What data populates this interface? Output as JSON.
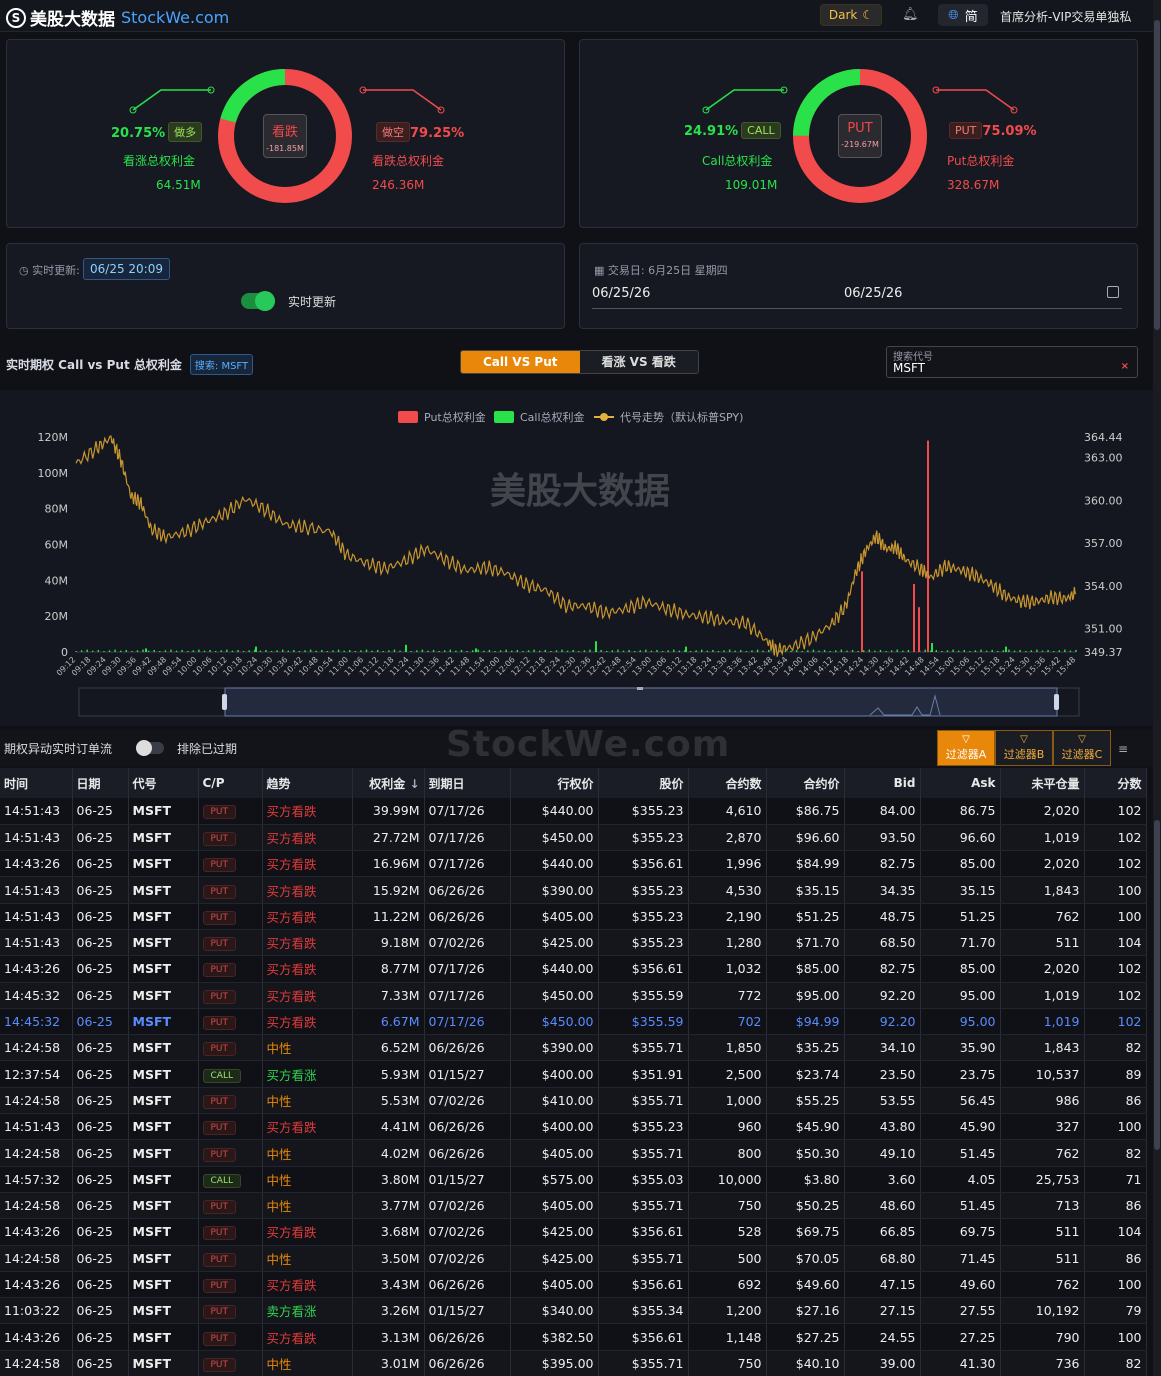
{
  "header": {
    "logo_mark": "S",
    "logo_cn": "美股大数据",
    "logo_en": "StockWe.com",
    "dark_label": "Dark",
    "lang_label": "简",
    "nav_text": "首席分析-VIP交易单独私"
  },
  "panel1": {
    "center_title": "看跌",
    "center_value": "-181.85M",
    "left_pct": "20.75%",
    "left_tag": "做多",
    "left_label": "看涨总权利金",
    "left_value": "64.51M",
    "right_tag": "做空",
    "right_pct": "79.25%",
    "right_label": "看跌总权利金",
    "right_value": "246.36M",
    "green_fraction": 0.2075
  },
  "panel2": {
    "center_title": "PUT",
    "center_value": "-219.67M",
    "left_pct": "24.91%",
    "left_tag": "CALL",
    "left_label": "Call总权利金",
    "left_value": "109.01M",
    "right_tag": "PUT",
    "right_pct": "75.09%",
    "right_label": "Put总权利金",
    "right_value": "328.67M",
    "green_fraction": 0.2491
  },
  "realtime": {
    "label": "实时更新:",
    "time": "06/25 20:09",
    "toggle_label": "实时更新"
  },
  "dates": {
    "label": "交易日: 6月25日 星期四",
    "start": "06/25/26",
    "end": "06/25/26"
  },
  "chart_header": {
    "title": "实时期权 Call vs Put 总权利金",
    "search_badge": "搜索: MSFT",
    "seg_active": "Call VS Put",
    "seg_inactive": "看涨 VS 看跌",
    "search_label": "搜索代号",
    "search_value": "MSFT",
    "search_clear": "×"
  },
  "colors": {
    "put": "#f24b4b",
    "call": "#29e24a",
    "price_line": "#c8962e",
    "accent": "#e8870a"
  },
  "chart_data": {
    "type": "bar",
    "watermark": "美股大数据",
    "legend": [
      "Put总权利金",
      "Call总权利金",
      "代号走势（默认标普SPY)"
    ],
    "legend_position": "top-center",
    "ylim_left": [
      0,
      120
    ],
    "yticks_left": [
      "0",
      "20M",
      "40M",
      "60M",
      "80M",
      "100M",
      "120M"
    ],
    "ylim_right": [
      349.37,
      364.44
    ],
    "yticks_right": [
      "349.37",
      "351.00",
      "354.00",
      "357.00",
      "360.00",
      "363.00",
      "364.44"
    ],
    "x_ticks": [
      "09:12",
      "09:18",
      "09:24",
      "09:30",
      "09:36",
      "09:42",
      "09:48",
      "09:54",
      "10:00",
      "10:06",
      "10:12",
      "10:18",
      "10:24",
      "10:30",
      "10:36",
      "10:42",
      "10:48",
      "10:54",
      "11:00",
      "11:06",
      "11:12",
      "11:18",
      "11:24",
      "11:30",
      "11:36",
      "11:42",
      "11:48",
      "11:54",
      "12:00",
      "12:06",
      "12:12",
      "12:18",
      "12:24",
      "12:30",
      "12:36",
      "12:42",
      "12:48",
      "12:54",
      "13:00",
      "13:06",
      "13:12",
      "13:18",
      "13:24",
      "13:30",
      "13:36",
      "13:42",
      "13:48",
      "13:54",
      "14:00",
      "14:06",
      "14:12",
      "14:18",
      "14:24",
      "14:30",
      "14:36",
      "14:42",
      "14:48",
      "14:54",
      "15:00",
      "15:06",
      "15:12",
      "15:18",
      "15:24",
      "15:30",
      "15:36",
      "15:42",
      "15:48"
    ],
    "price_series": [
      {
        "t": 0.0,
        "p": 362.6
      },
      {
        "t": 0.02,
        "p": 363.6
      },
      {
        "t": 0.035,
        "p": 364.4
      },
      {
        "t": 0.045,
        "p": 362.8
      },
      {
        "t": 0.055,
        "p": 360.3
      },
      {
        "t": 0.065,
        "p": 359.8
      },
      {
        "t": 0.075,
        "p": 358.0
      },
      {
        "t": 0.09,
        "p": 357.4
      },
      {
        "t": 0.11,
        "p": 357.8
      },
      {
        "t": 0.13,
        "p": 358.5
      },
      {
        "t": 0.15,
        "p": 359.1
      },
      {
        "t": 0.17,
        "p": 360.1
      },
      {
        "t": 0.19,
        "p": 359.3
      },
      {
        "t": 0.21,
        "p": 358.3
      },
      {
        "t": 0.23,
        "p": 358.1
      },
      {
        "t": 0.255,
        "p": 357.8
      },
      {
        "t": 0.27,
        "p": 356.2
      },
      {
        "t": 0.29,
        "p": 355.6
      },
      {
        "t": 0.31,
        "p": 355.2
      },
      {
        "t": 0.33,
        "p": 355.8
      },
      {
        "t": 0.35,
        "p": 356.6
      },
      {
        "t": 0.37,
        "p": 355.8
      },
      {
        "t": 0.39,
        "p": 355.1
      },
      {
        "t": 0.41,
        "p": 355.3
      },
      {
        "t": 0.43,
        "p": 354.9
      },
      {
        "t": 0.45,
        "p": 354.1
      },
      {
        "t": 0.47,
        "p": 353.7
      },
      {
        "t": 0.49,
        "p": 352.6
      },
      {
        "t": 0.51,
        "p": 352.6
      },
      {
        "t": 0.53,
        "p": 352.1
      },
      {
        "t": 0.55,
        "p": 352.4
      },
      {
        "t": 0.57,
        "p": 352.9
      },
      {
        "t": 0.59,
        "p": 352.4
      },
      {
        "t": 0.61,
        "p": 352.0
      },
      {
        "t": 0.63,
        "p": 351.8
      },
      {
        "t": 0.65,
        "p": 351.5
      },
      {
        "t": 0.67,
        "p": 351.4
      },
      {
        "t": 0.69,
        "p": 350.2
      },
      {
        "t": 0.7,
        "p": 349.5
      },
      {
        "t": 0.715,
        "p": 349.7
      },
      {
        "t": 0.735,
        "p": 350.3
      },
      {
        "t": 0.755,
        "p": 351.3
      },
      {
        "t": 0.77,
        "p": 352.6
      },
      {
        "t": 0.78,
        "p": 355.0
      },
      {
        "t": 0.79,
        "p": 356.5
      },
      {
        "t": 0.8,
        "p": 357.5
      },
      {
        "t": 0.81,
        "p": 356.6
      },
      {
        "t": 0.82,
        "p": 356.7
      },
      {
        "t": 0.83,
        "p": 355.8
      },
      {
        "t": 0.845,
        "p": 355.2
      },
      {
        "t": 0.855,
        "p": 354.6
      },
      {
        "t": 0.87,
        "p": 355.4
      },
      {
        "t": 0.885,
        "p": 355.1
      },
      {
        "t": 0.9,
        "p": 354.7
      },
      {
        "t": 0.915,
        "p": 354.1
      },
      {
        "t": 0.93,
        "p": 353.3
      },
      {
        "t": 0.945,
        "p": 352.9
      },
      {
        "t": 0.96,
        "p": 352.9
      },
      {
        "t": 0.975,
        "p": 353.2
      },
      {
        "t": 0.99,
        "p": 353.1
      },
      {
        "t": 1.0,
        "p": 353.5
      }
    ],
    "put_bars": [
      {
        "t": 0.786,
        "v": 45
      },
      {
        "t": 0.838,
        "v": 38
      },
      {
        "t": 0.843,
        "v": 25
      },
      {
        "t": 0.852,
        "v": 118
      }
    ],
    "call_bars": [
      {
        "t": 0.52,
        "v": 6
      },
      {
        "t": 0.33,
        "v": 4
      },
      {
        "t": 0.18,
        "v": 3
      },
      {
        "t": 0.61,
        "v": 3
      },
      {
        "t": 0.856,
        "v": 5
      },
      {
        "t": 0.07,
        "v": 2
      },
      {
        "t": 0.4,
        "v": 2
      },
      {
        "t": 0.93,
        "v": 3
      }
    ]
  },
  "flow": {
    "title": "期权异动实时订单流",
    "exclude_label": "排除已过期",
    "watermark": "StockWe.com",
    "filters": [
      "过滤器A",
      "过滤器B",
      "过滤器C"
    ],
    "columns": [
      "时间",
      "日期",
      "代号",
      "C/P",
      "趋势",
      "权利金",
      "到期日",
      "行权价",
      "股价",
      "合约数",
      "合约价",
      "Bid",
      "Ask",
      "未平仓量",
      "分数"
    ],
    "rows": [
      [
        "14:51:43",
        "06-25",
        "MSFT",
        "PUT",
        "买方看跌",
        "39.99M",
        "07/17/26",
        "$440.00",
        "$355.23",
        "4,610",
        "$86.75",
        "84.00",
        "86.75",
        "2,020",
        "102"
      ],
      [
        "14:51:43",
        "06-25",
        "MSFT",
        "PUT",
        "买方看跌",
        "27.72M",
        "07/17/26",
        "$450.00",
        "$355.23",
        "2,870",
        "$96.60",
        "93.50",
        "96.60",
        "1,019",
        "102"
      ],
      [
        "14:43:26",
        "06-25",
        "MSFT",
        "PUT",
        "买方看跌",
        "16.96M",
        "07/17/26",
        "$440.00",
        "$356.61",
        "1,996",
        "$84.99",
        "82.75",
        "85.00",
        "2,020",
        "102"
      ],
      [
        "14:51:43",
        "06-25",
        "MSFT",
        "PUT",
        "买方看跌",
        "15.92M",
        "06/26/26",
        "$390.00",
        "$355.23",
        "4,530",
        "$35.15",
        "34.35",
        "35.15",
        "1,843",
        "100"
      ],
      [
        "14:51:43",
        "06-25",
        "MSFT",
        "PUT",
        "买方看跌",
        "11.22M",
        "06/26/26",
        "$405.00",
        "$355.23",
        "2,190",
        "$51.25",
        "48.75",
        "51.25",
        "762",
        "100"
      ],
      [
        "14:51:43",
        "06-25",
        "MSFT",
        "PUT",
        "买方看跌",
        "9.18M",
        "07/02/26",
        "$425.00",
        "$355.23",
        "1,280",
        "$71.70",
        "68.50",
        "71.70",
        "511",
        "104"
      ],
      [
        "14:43:26",
        "06-25",
        "MSFT",
        "PUT",
        "买方看跌",
        "8.77M",
        "07/17/26",
        "$440.00",
        "$356.61",
        "1,032",
        "$85.00",
        "82.75",
        "85.00",
        "2,020",
        "102"
      ],
      [
        "14:45:32",
        "06-25",
        "MSFT",
        "PUT",
        "买方看跌",
        "7.33M",
        "07/17/26",
        "$450.00",
        "$355.59",
        "772",
        "$95.00",
        "92.20",
        "95.00",
        "1,019",
        "102"
      ],
      [
        "14:45:32",
        "06-25",
        "MSFT",
        "PUT",
        "买方看跌",
        "6.67M",
        "07/17/26",
        "$450.00",
        "$355.59",
        "702",
        "$94.99",
        "92.20",
        "95.00",
        "1,019",
        "102"
      ],
      [
        "14:24:58",
        "06-25",
        "MSFT",
        "PUT",
        "中性",
        "6.52M",
        "06/26/26",
        "$390.00",
        "$355.71",
        "1,850",
        "$35.25",
        "34.10",
        "35.90",
        "1,843",
        "82"
      ],
      [
        "12:37:54",
        "06-25",
        "MSFT",
        "CALL",
        "买方看涨",
        "5.93M",
        "01/15/27",
        "$400.00",
        "$351.91",
        "2,500",
        "$23.74",
        "23.50",
        "23.75",
        "10,537",
        "89"
      ],
      [
        "14:24:58",
        "06-25",
        "MSFT",
        "PUT",
        "中性",
        "5.53M",
        "07/02/26",
        "$410.00",
        "$355.71",
        "1,000",
        "$55.25",
        "53.55",
        "56.45",
        "986",
        "86"
      ],
      [
        "14:51:43",
        "06-25",
        "MSFT",
        "PUT",
        "买方看跌",
        "4.41M",
        "06/26/26",
        "$400.00",
        "$355.23",
        "960",
        "$45.90",
        "43.80",
        "45.90",
        "327",
        "100"
      ],
      [
        "14:24:58",
        "06-25",
        "MSFT",
        "PUT",
        "中性",
        "4.02M",
        "06/26/26",
        "$405.00",
        "$355.71",
        "800",
        "$50.30",
        "49.10",
        "51.45",
        "762",
        "82"
      ],
      [
        "14:57:32",
        "06-25",
        "MSFT",
        "CALL",
        "中性",
        "3.80M",
        "01/15/27",
        "$575.00",
        "$355.03",
        "10,000",
        "$3.80",
        "3.60",
        "4.05",
        "25,753",
        "71"
      ],
      [
        "14:24:58",
        "06-25",
        "MSFT",
        "PUT",
        "中性",
        "3.77M",
        "07/02/26",
        "$405.00",
        "$355.71",
        "750",
        "$50.25",
        "48.60",
        "51.45",
        "713",
        "86"
      ],
      [
        "14:43:26",
        "06-25",
        "MSFT",
        "PUT",
        "买方看跌",
        "3.68M",
        "07/02/26",
        "$425.00",
        "$356.61",
        "528",
        "$69.75",
        "66.85",
        "69.75",
        "511",
        "104"
      ],
      [
        "14:24:58",
        "06-25",
        "MSFT",
        "PUT",
        "中性",
        "3.50M",
        "07/02/26",
        "$425.00",
        "$355.71",
        "500",
        "$70.05",
        "68.80",
        "71.45",
        "511",
        "86"
      ],
      [
        "14:43:26",
        "06-25",
        "MSFT",
        "PUT",
        "买方看跌",
        "3.43M",
        "06/26/26",
        "$405.00",
        "$356.61",
        "692",
        "$49.60",
        "47.15",
        "49.60",
        "762",
        "100"
      ],
      [
        "11:03:22",
        "06-25",
        "MSFT",
        "PUT",
        "卖方看涨",
        "3.26M",
        "01/15/27",
        "$340.00",
        "$355.34",
        "1,200",
        "$27.16",
        "27.15",
        "27.55",
        "10,192",
        "79"
      ],
      [
        "14:43:26",
        "06-25",
        "MSFT",
        "PUT",
        "买方看跌",
        "3.13M",
        "06/26/26",
        "$382.50",
        "$356.61",
        "1,148",
        "$27.25",
        "24.55",
        "27.25",
        "790",
        "100"
      ],
      [
        "14:24:58",
        "06-25",
        "MSFT",
        "PUT",
        "中性",
        "3.01M",
        "06/26/26",
        "$395.00",
        "$355.71",
        "750",
        "$40.10",
        "39.00",
        "41.30",
        "736",
        "82"
      ]
    ],
    "selected_row": 8
  }
}
